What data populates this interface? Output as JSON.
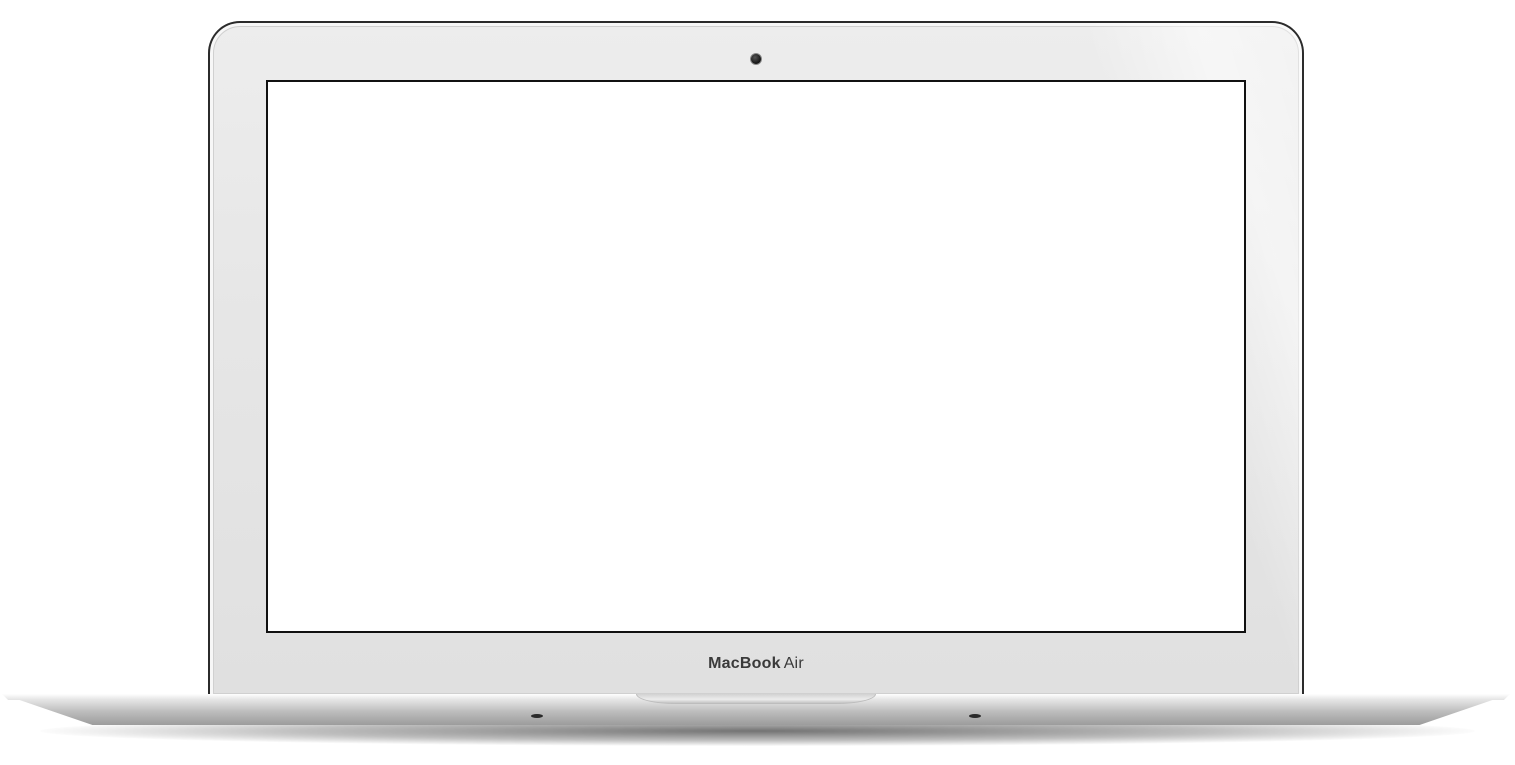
{
  "device": {
    "brand_primary": "MacBook",
    "brand_secondary": "Air"
  },
  "colors": {
    "bezel": "#e6e6e6",
    "screen": "#ffffff",
    "frame_border": "#2b2b2b",
    "brand_text": "#3a3a3a"
  },
  "icons": {
    "camera": "camera-icon"
  }
}
